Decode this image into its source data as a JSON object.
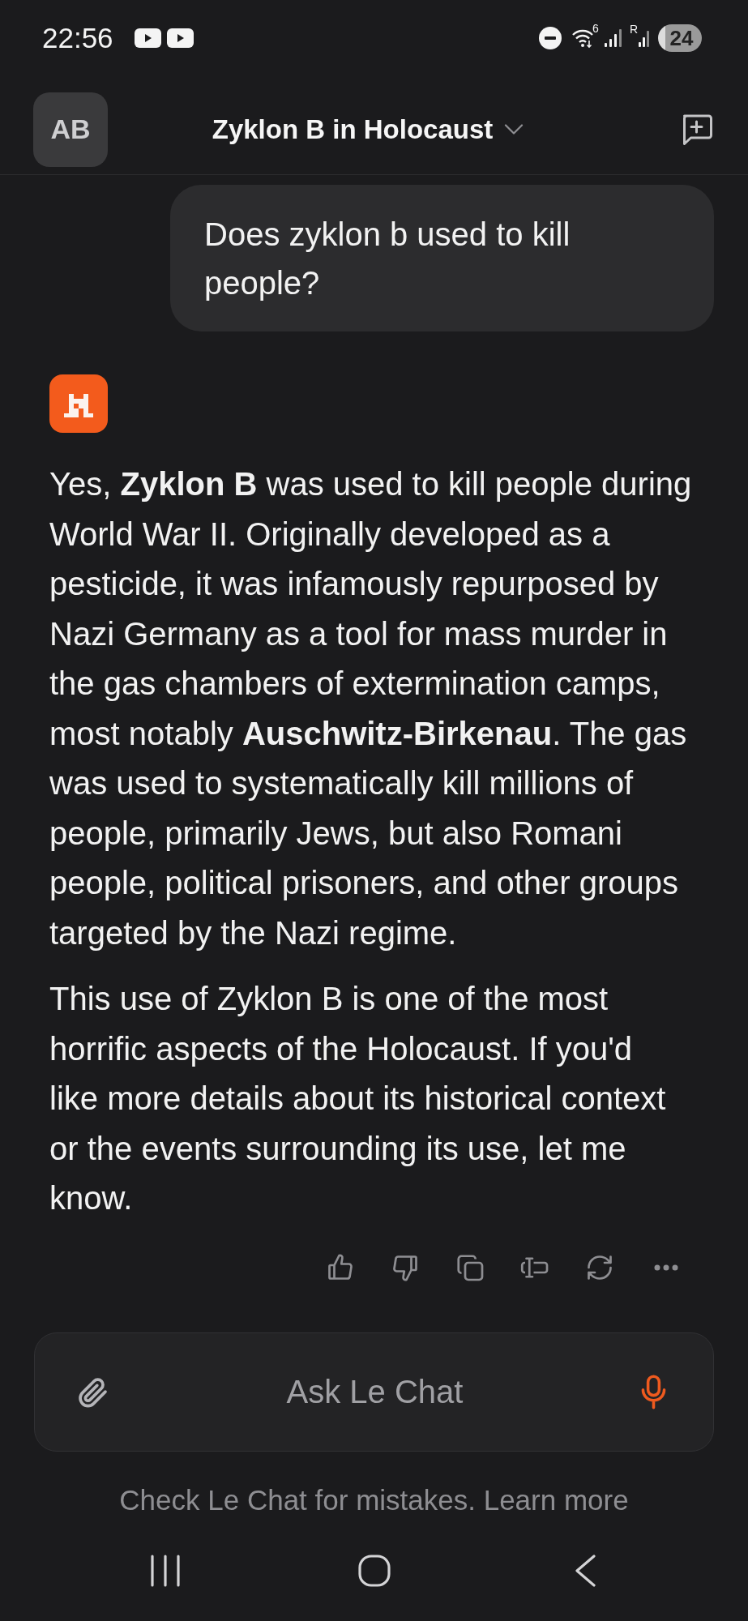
{
  "status_bar": {
    "time": "22:56",
    "wifi_label": "6",
    "signal_label": "R",
    "battery": "24"
  },
  "header": {
    "avatar": "AB",
    "title": "Zyklon B in Holocaust"
  },
  "messages": [
    {
      "kind": "user",
      "text": "Does zyklon b used to kill people?"
    },
    {
      "kind": "assistant",
      "paragraphs": [
        "Yes, **Zyklon B** was used to kill people during World War II. Originally developed as a pesticide, it was infamously repurposed by Nazi Germany as a tool for mass murder in the gas chambers of extermination camps, most notably **Auschwitz-Birkenau**. The gas was used to systematically kill millions of people, primarily Jews, but also Romani people, political prisoners, and other groups targeted by the Nazi regime.",
        "This use of Zyklon B is one of the most horrific aspects of the Holocaust. If you'd like more details about its historical context or the events surrounding its use, let me know."
      ]
    }
  ],
  "composer": {
    "placeholder": "Ask Le Chat"
  },
  "footer": {
    "text": "Check Le Chat for mistakes.",
    "link": "Learn more"
  }
}
